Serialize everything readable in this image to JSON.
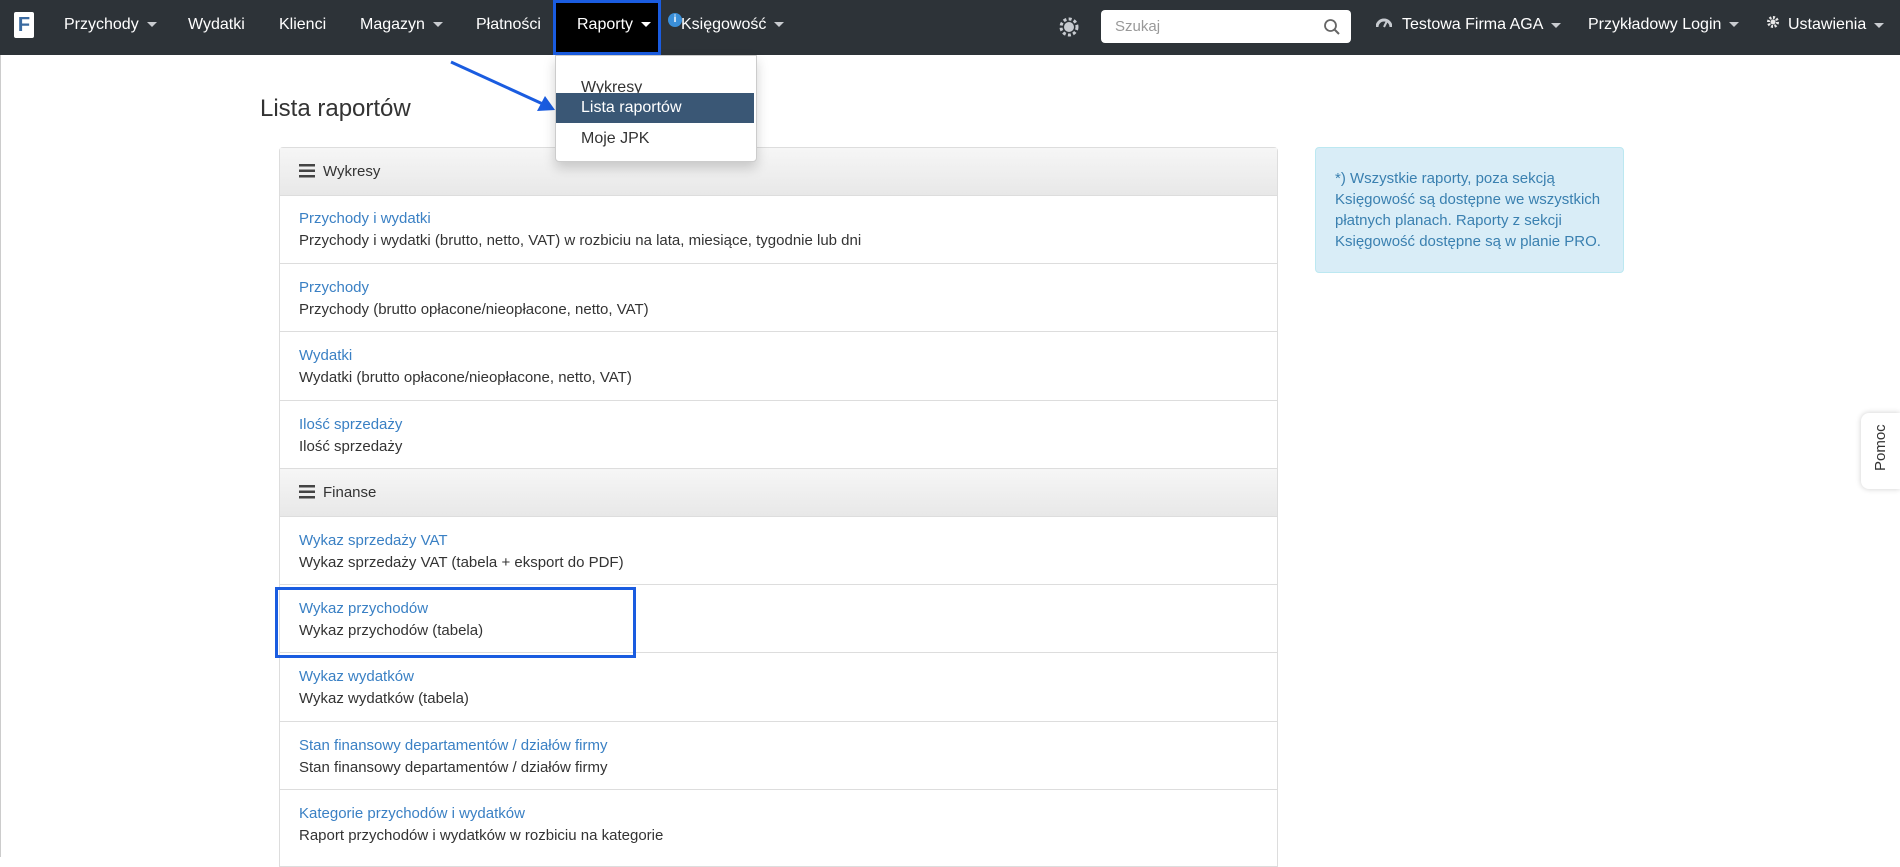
{
  "nav": {
    "logo": "F",
    "items": [
      {
        "label": "Przychody",
        "caret": true
      },
      {
        "label": "Wydatki",
        "caret": false
      },
      {
        "label": "Klienci",
        "caret": false
      },
      {
        "label": "Magazyn",
        "caret": true
      },
      {
        "label": "Płatności",
        "caret": false
      },
      {
        "label": "Raporty",
        "caret": true,
        "active": true
      },
      {
        "label": "Księgowość",
        "caret": true
      }
    ],
    "badge": "i",
    "search_placeholder": "Szukaj",
    "company": "Testowa Firma AGA",
    "login": "Przykładowy Login",
    "settings": "Ustawienia"
  },
  "dropdown": {
    "items": [
      {
        "label": "Wykresy",
        "active": false
      },
      {
        "label": "Lista raportów",
        "active": true
      },
      {
        "label": "Moje JPK",
        "active": false
      }
    ]
  },
  "page_title": "Lista raportów",
  "sections": [
    {
      "title": "Wykresy",
      "reports": [
        {
          "link": "Przychody i wydatki",
          "desc": "Przychody i wydatki (brutto, netto, VAT) w rozbiciu na lata, miesiące, tygodnie lub dni"
        },
        {
          "link": "Przychody",
          "desc": "Przychody (brutto opłacone/nieopłacone, netto, VAT)"
        },
        {
          "link": "Wydatki",
          "desc": "Wydatki (brutto opłacone/nieopłacone, netto, VAT)"
        },
        {
          "link": "Ilość sprzedaży",
          "desc": "Ilość sprzedaży"
        }
      ]
    },
    {
      "title": "Finanse",
      "reports": [
        {
          "link": "Wykaz sprzedaży VAT",
          "desc": "Wykaz sprzedaży VAT (tabela + eksport do PDF)"
        },
        {
          "link": "Wykaz przychodów",
          "desc": "Wykaz przychodów (tabela)"
        },
        {
          "link": "Wykaz wydatków",
          "desc": "Wykaz wydatków (tabela)"
        },
        {
          "link": "Stan finansowy departamentów / działów firmy",
          "desc": "Stan finansowy departamentów / działów firmy"
        },
        {
          "link": "Kategorie przychodów i wydatków",
          "desc": "Raport przychodów i wydatków w rozbiciu na kategorie"
        }
      ]
    }
  ],
  "info_box": "*) Wszystkie raporty, poza sekcją Księgowość są dostępne we wszystkich płatnych planach. Raporty z sekcji Księgowość dostępne są w planie PRO.",
  "help_tab": "Pomoc",
  "colors": {
    "navbar": "#2d3338",
    "link": "#3a80c4",
    "dropdown_active": "#3a5775",
    "annotation": "#1a5ce0",
    "info_bg": "#d9edf7"
  }
}
